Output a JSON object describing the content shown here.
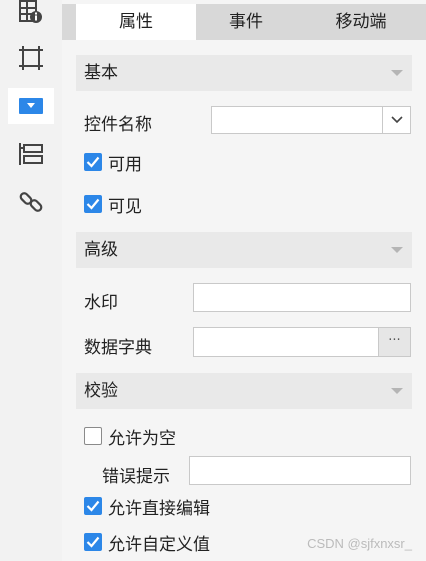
{
  "toolbar": {
    "items": [
      {
        "icon": "table-info-icon"
      },
      {
        "icon": "frame-icon"
      },
      {
        "icon": "dropdown-widget-icon",
        "active": true
      },
      {
        "icon": "layout-icon"
      },
      {
        "icon": "link-icon"
      }
    ]
  },
  "tabs": [
    {
      "label": "属性",
      "active": true
    },
    {
      "label": "事件"
    },
    {
      "label": "移动端"
    }
  ],
  "sections": {
    "basic": {
      "title": "基本"
    },
    "advanced": {
      "title": "高级"
    },
    "validation": {
      "title": "校验"
    }
  },
  "basic": {
    "widget_name_label": "控件名称",
    "widget_name_value": "",
    "enabled": {
      "label": "可用",
      "checked": true
    },
    "visible": {
      "label": "可见",
      "checked": true
    }
  },
  "advanced": {
    "watermark_label": "水印",
    "watermark_value": "",
    "data_dict_label": "数据字典",
    "data_dict_value": "",
    "more_button": "···"
  },
  "validation": {
    "allow_empty": {
      "label": "允许为空",
      "checked": false
    },
    "error_hint_label": "错误提示",
    "error_hint_value": "",
    "allow_direct_edit": {
      "label": "允许直接编辑",
      "checked": true
    },
    "allow_custom_value": {
      "label": "允许自定义值",
      "checked": true
    }
  },
  "footer_watermark": "CSDN @sjfxnxsr_",
  "colors": {
    "accent": "#2c87e8",
    "tab_bar": "#d8d8d8",
    "section": "#e9e9e9"
  }
}
